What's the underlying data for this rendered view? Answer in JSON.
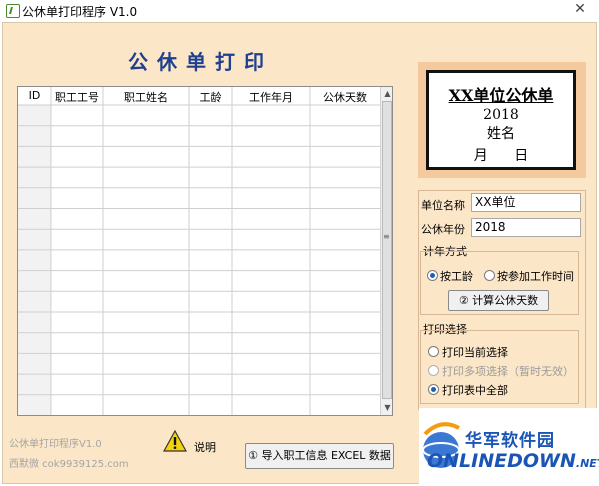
{
  "window": {
    "title": "公休单打印程序 V1.0",
    "close_glyph": "✕"
  },
  "main_title": "公休单打印",
  "table": {
    "columns": [
      "ID",
      "职工工号",
      "职工姓名",
      "工龄",
      "工作年月",
      "公休天数"
    ],
    "rows": []
  },
  "preview": {
    "title": "XX单位公休单",
    "year": "2018",
    "name": "姓名",
    "date": "月 日"
  },
  "form": {
    "unit_name_label": "单位名称",
    "unit_name_value": "XX单位",
    "year_label": "公休年份",
    "year_value": "2018"
  },
  "calc_mode": {
    "label": "计年方式",
    "options": [
      "按工龄",
      "按参加工作时间"
    ],
    "selected": "按工龄",
    "calc_button": "② 计算公休天数"
  },
  "print_mode": {
    "label": "打印选择",
    "options": [
      "打印当前选择",
      "打印多项选择（暂时无效）",
      "打印表中全部"
    ],
    "selected": "打印表中全部"
  },
  "footer": {
    "app_name": "公休单打印程序V1.0",
    "author": "西默微 cok9939125.com"
  },
  "help_label": "说明",
  "import_button": "① 导入职工信息 EXCEL 数据",
  "watermark": {
    "cn": "华军软件园",
    "en_main": "ONLINEDOWN",
    "en_suffix": ".NET"
  }
}
